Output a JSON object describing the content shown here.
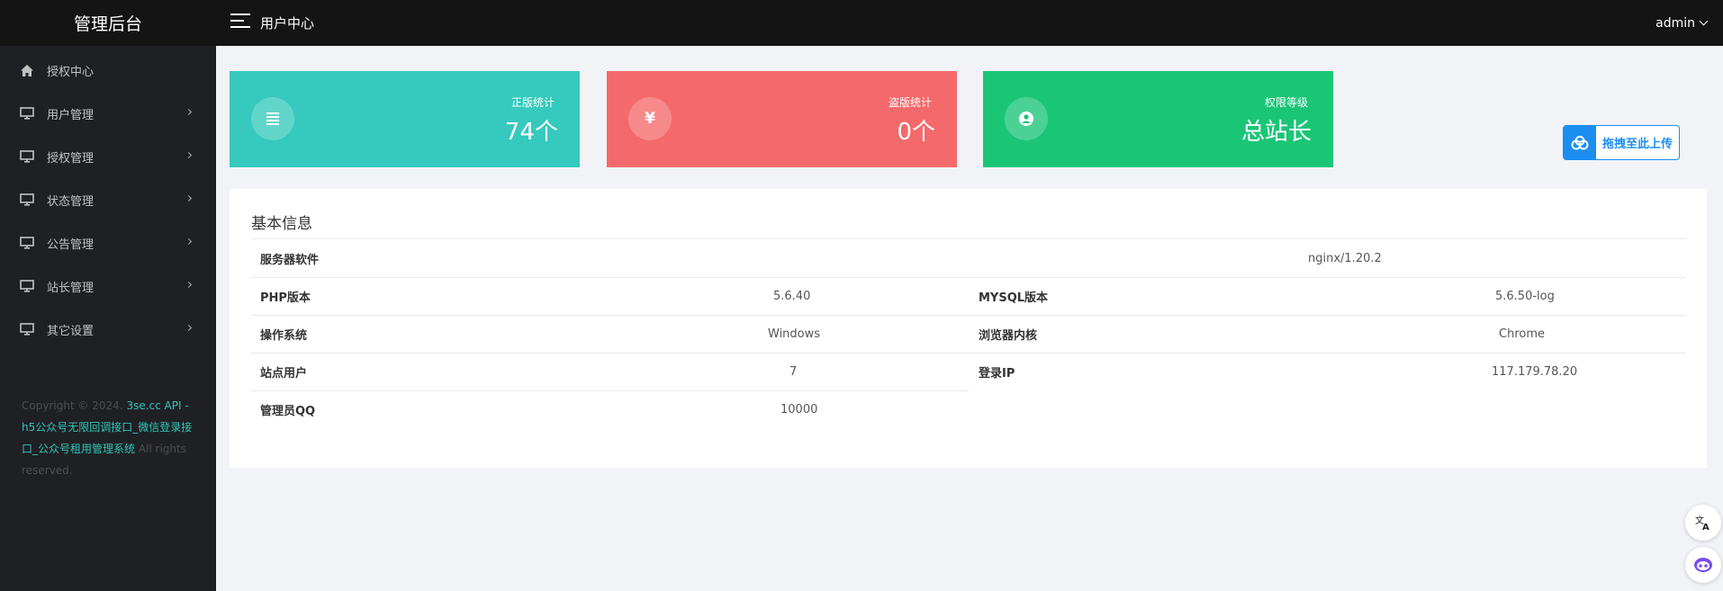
{
  "app": {
    "brand": "管理后台",
    "title": "用户中心",
    "user": "admin"
  },
  "sidebar": {
    "items": [
      {
        "label": "授权中心",
        "icon": "home-icon",
        "has_submenu": false
      },
      {
        "label": "用户管理",
        "icon": "monitor-icon",
        "has_submenu": true
      },
      {
        "label": "授权管理",
        "icon": "monitor-icon",
        "has_submenu": true
      },
      {
        "label": "状态管理",
        "icon": "monitor-icon",
        "has_submenu": true
      },
      {
        "label": "公告管理",
        "icon": "monitor-icon",
        "has_submenu": true
      },
      {
        "label": "站长管理",
        "icon": "monitor-icon",
        "has_submenu": true
      },
      {
        "label": "其它设置",
        "icon": "monitor-icon",
        "has_submenu": true
      }
    ],
    "footer": {
      "prefix": "Copyright © 2024. ",
      "link": "3se.cc API - h5公众号无限回调接口_微信登录接口_公众号租用管理系统",
      "suffix": " All rights reserved."
    }
  },
  "stats": [
    {
      "label": "正版统计",
      "value": "74个",
      "icon": "list-icon",
      "color": "#36c9bd"
    },
    {
      "label": "盗版统计",
      "value": "0个",
      "icon": "yen-icon",
      "color": "#f4696b"
    },
    {
      "label": "权限等级",
      "value": "总站长",
      "icon": "user-circle-icon",
      "color": "#1ac576"
    }
  ],
  "upload": {
    "label": "拖拽至此上传",
    "icon": "cloud-upload-icon"
  },
  "info": {
    "title": "基本信息",
    "server_label": "服务器软件",
    "server_value": "nginx/1.20.2",
    "rows": [
      {
        "k1": "PHP版本",
        "v1": "5.6.40",
        "k2": "MYSQL版本",
        "v2": "5.6.50-log"
      },
      {
        "k1": "操作系统",
        "v1": "Windows",
        "k2": "浏览器内核",
        "v2": "Chrome"
      },
      {
        "k1": "站点用户",
        "v1": "7",
        "k2": "登录IP",
        "v2": "117.179.78.20"
      },
      {
        "k1": "管理员QQ",
        "v1": "10000"
      }
    ]
  },
  "floating_tools": [
    {
      "icon": "translate-icon"
    },
    {
      "icon": "robot-icon"
    }
  ]
}
